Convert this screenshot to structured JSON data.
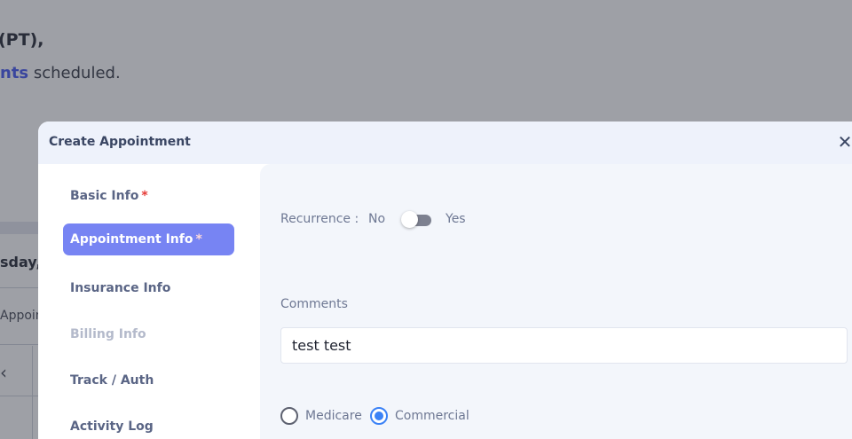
{
  "background": {
    "heading": "(PT),",
    "sub_accent": "nts",
    "sub_rest": " scheduled.",
    "date": "sday, .",
    "appoint": "Appoint",
    "prev_glyph": "‹"
  },
  "modal": {
    "title": "Create Appointment",
    "close_glyph": "✕",
    "nav": [
      {
        "label": "Basic Info",
        "required": "*"
      },
      {
        "label": "Appointment Info",
        "required": "*"
      },
      {
        "label": "Insurance Info"
      },
      {
        "label": "Billing Info"
      },
      {
        "label": "Track / Auth"
      },
      {
        "label": "Activity Log"
      }
    ],
    "recurrence": {
      "label": "Recurrence :",
      "no": "No",
      "yes": "Yes",
      "value": false
    },
    "comments": {
      "label": "Comments",
      "value": "test test"
    },
    "payer": {
      "options": [
        "Medicare",
        "Commercial"
      ],
      "selected": "Commercial"
    }
  },
  "colors": {
    "accent": "#7784f3",
    "radio_selected": "#3b82f6",
    "required": "#e53935"
  }
}
